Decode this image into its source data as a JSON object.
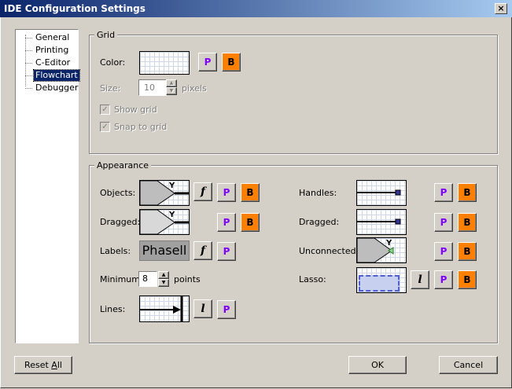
{
  "window": {
    "title": "IDE Configuration Settings",
    "close_glyph": "×"
  },
  "tree": {
    "items": [
      {
        "label": "General",
        "selected": false
      },
      {
        "label": "Printing",
        "selected": false
      },
      {
        "label": "C-Editor",
        "selected": false
      },
      {
        "label": "Flowchart",
        "selected": true
      },
      {
        "label": "Debugger",
        "selected": false
      }
    ]
  },
  "grid_group": {
    "title": "Grid",
    "color_label": "Color:",
    "size_label": "Size:",
    "size_value": "10",
    "size_unit": "pixels",
    "show_grid": "Show grid",
    "snap_to_grid": "Snap to grid"
  },
  "appearance": {
    "title": "Appearance",
    "objects_label": "Objects:",
    "dragged_label": "Dragged:",
    "labels_label": "Labels:",
    "labels_sample": "Phasell",
    "minimum_label": "Minimum:",
    "minimum_value": "8",
    "minimum_unit": "points",
    "lines_label": "Lines:",
    "handles_label": "Handles:",
    "dragged2_label": "Dragged:",
    "unconnected_label": "Unconnected:",
    "lasso_label": "Lasso:"
  },
  "buttons": {
    "p": "P",
    "b": "B",
    "f": "f",
    "l": "l",
    "reset_prefix": "Reset ",
    "reset_accel": "A",
    "reset_suffix": "ll",
    "ok": "OK",
    "cancel": "Cancel"
  },
  "glyphs": {
    "check": "✓",
    "up": "▲",
    "down": "▼",
    "y": "Y"
  },
  "colors": {
    "accent_orange": "#ff8000",
    "accent_purple": "#8000ff",
    "title_bar": "#0a246a"
  }
}
